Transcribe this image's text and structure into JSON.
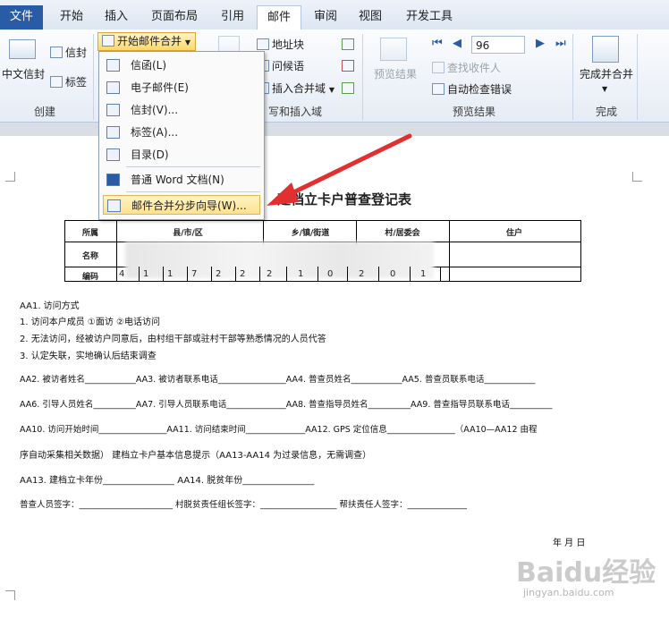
{
  "tabs": [
    "文件",
    "开始",
    "插入",
    "页面布局",
    "引用",
    "邮件",
    "审阅",
    "视图",
    "开发工具"
  ],
  "ribbon": {
    "create": {
      "label": "创建",
      "chinese_envelope": "中文信封",
      "envelope": "信封",
      "labels": "标签"
    },
    "start": {
      "start_merge": "开始邮件合并"
    },
    "write": {
      "label": "写和插入域",
      "address_block": "地址块",
      "greeting": "问候语",
      "insert_merge_field": "插入合并域"
    },
    "preview": {
      "label": "预览结果",
      "preview_results": "预览结果",
      "find_recipient": "查找收件人",
      "auto_check": "自动检查错误",
      "record": "96"
    },
    "finish": {
      "label": "完成",
      "finish_merge": "完成并合并"
    }
  },
  "menu": {
    "items": [
      "信函(L)",
      "电子邮件(E)",
      "信封(V)...",
      "标签(A)...",
      "目录(D)",
      "普通 Word 文档(N)",
      "邮件合并分步向导(W)..."
    ]
  },
  "doc": {
    "title": "建档立卡户普查登记表",
    "headers": [
      "所属",
      "县/市/区",
      "乡/镇/街道",
      "村/居委会",
      "住户"
    ],
    "row_labels": [
      "名称",
      "编码"
    ],
    "codes": [
      "4",
      "1",
      "1",
      "7",
      "2",
      "2",
      "2",
      "1",
      "0",
      "2",
      "0",
      "1"
    ],
    "lines": [
      "AA1. 访问方式",
      "1. 访问本户成员    ①面访    ②电话访问",
      "2. 无法访问，经被访户同意后，由村组干部或驻村干部等熟悉情况的人员代答",
      "3. 认定失联，实地确认后结束调查",
      "AA2. 被访者姓名____________AA3. 被访者联系电话________________AA4. 普查员姓名____________AA5. 普查员联系电话____________",
      "AA6. 引导人员姓名__________AA7. 引导人员联系电话______________AA8. 普查指导员姓名__________AA9. 普查指导员联系电话__________",
      "AA10. 访问开始时间________________AA11. 访问结束时间______________AA12. GPS 定位信息________________（AA10—AA12 由程",
      "序自动采集相关数据）        建档立卡户基本信息提示（AA13-AA14 为过录信息，无需调查）",
      "AA13. 建档立卡年份________________   AA14. 脱贫年份________________",
      "普查人员签字：______________________     村脱贫责任组长签字：__________________     帮扶责任人签字：______________"
    ],
    "date": "年    月    日"
  },
  "watermark": "Baidu经验",
  "watermark_url": "jingyan.baidu.com"
}
